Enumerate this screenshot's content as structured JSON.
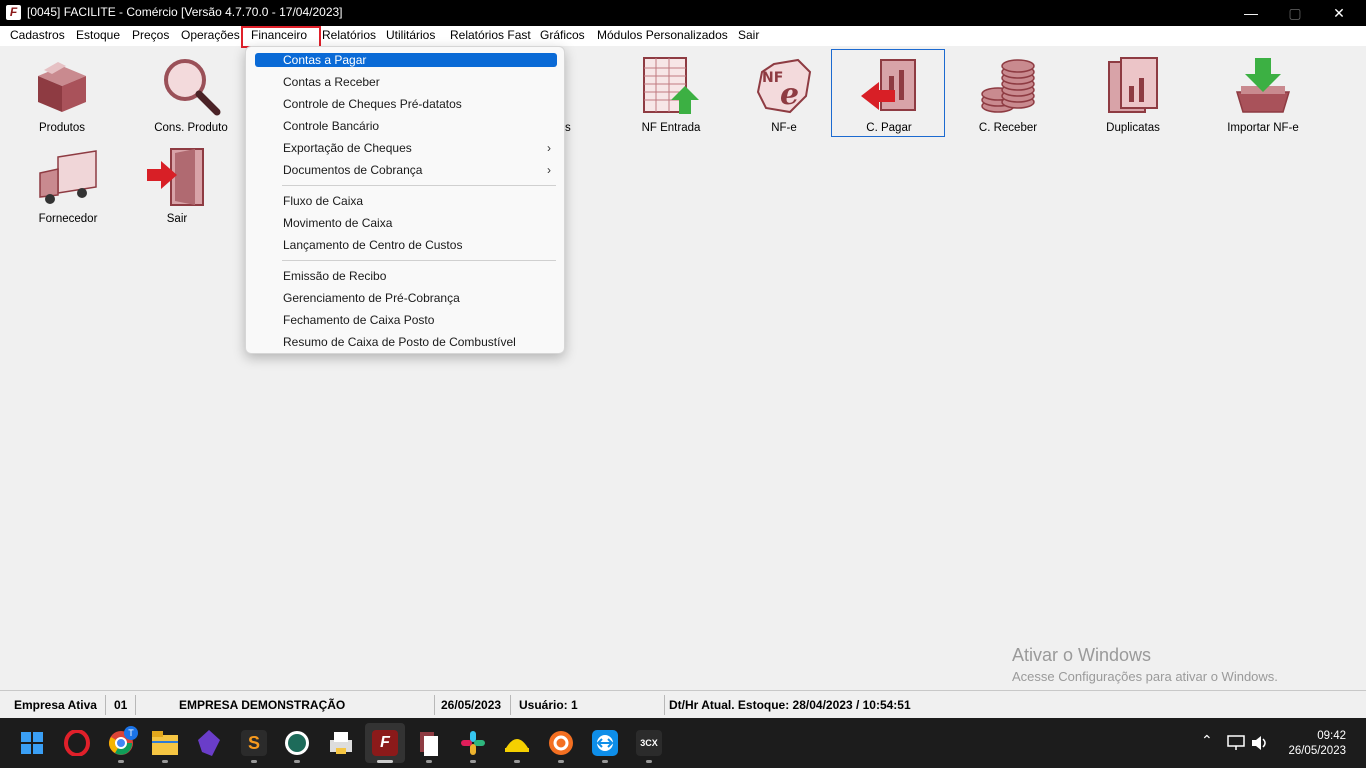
{
  "window": {
    "title": "[0045] FACILITE - Comércio [Versão 4.7.70.0 - 17/04/2023]",
    "app_icon_letter": "F",
    "controls": {
      "minimize": "—",
      "maximize": "▢",
      "close": "✕"
    }
  },
  "menubar": {
    "items": [
      "Cadastros",
      "Estoque",
      "Preços",
      "Operações",
      "Financeiro",
      "Relatórios",
      "Utilitários",
      "Relatórios Fast",
      "Gráficos",
      "Módulos Personalizados",
      "Sair"
    ],
    "highlighted": "Financeiro"
  },
  "toolbar_icons": [
    {
      "label": "Produtos",
      "icon": "box-icon"
    },
    {
      "label": "Cons. Produto",
      "icon": "magnifier-icon"
    },
    {
      "label": "NF Entrada",
      "icon": "spreadsheet-arrow-icon"
    },
    {
      "label": "NF-e",
      "icon": "nfe-logo-icon"
    },
    {
      "label": "C. Pagar",
      "icon": "document-arrow-out-icon"
    },
    {
      "label": "C. Receber",
      "icon": "coins-icon"
    },
    {
      "label": "Duplicatas",
      "icon": "documents-chart-icon"
    },
    {
      "label": "Importar NF-e",
      "icon": "download-tray-icon"
    },
    {
      "label": "Fornecedor",
      "icon": "truck-icon"
    },
    {
      "label": "Sair",
      "icon": "exit-door-icon"
    }
  ],
  "hidden_label_fragment": "s",
  "dropdown": {
    "items": [
      {
        "label": "Contas a Pagar",
        "active": true
      },
      {
        "label": "Contas a Receber"
      },
      {
        "label": "Controle de Cheques Pré-datatos"
      },
      {
        "label": "Controle Bancário"
      },
      {
        "label": "Exportação de Cheques",
        "submenu": true
      },
      {
        "label": "Documentos de Cobrança",
        "submenu": true
      },
      {
        "label": "Fluxo de Caixa"
      },
      {
        "label": "Movimento de Caixa"
      },
      {
        "label": "Lançamento de Centro de Custos"
      },
      {
        "label": "Emissão de Recibo"
      },
      {
        "label": "Gerenciamento de Pré-Cobrança"
      },
      {
        "label": "Fechamento de Caixa Posto"
      },
      {
        "label": "Resumo de Caixa de Posto de Combustível"
      }
    ],
    "submenu_arrow": "›"
  },
  "watermark": {
    "line1": "Ativar o Windows",
    "line2": "Acesse Configurações para ativar o Windows."
  },
  "statusbar": {
    "empresa_label": "Empresa Ativa",
    "empresa_code": "01",
    "empresa_name": "EMPRESA DEMONSTRAÇÃO",
    "date": "26/05/2023",
    "usuario": "Usuário: 1",
    "estoque": "Dt/Hr Atual. Estoque: 28/04/2023 / 10:54:51"
  },
  "taskbar": {
    "time": "09:42",
    "date": "26/05/2023",
    "badge": "T",
    "app_3cx": "3CX"
  },
  "colors": {
    "accent": "#0a6ad6",
    "highlight_box": "#e0202a",
    "icon_maroon": "#8e3b42"
  }
}
